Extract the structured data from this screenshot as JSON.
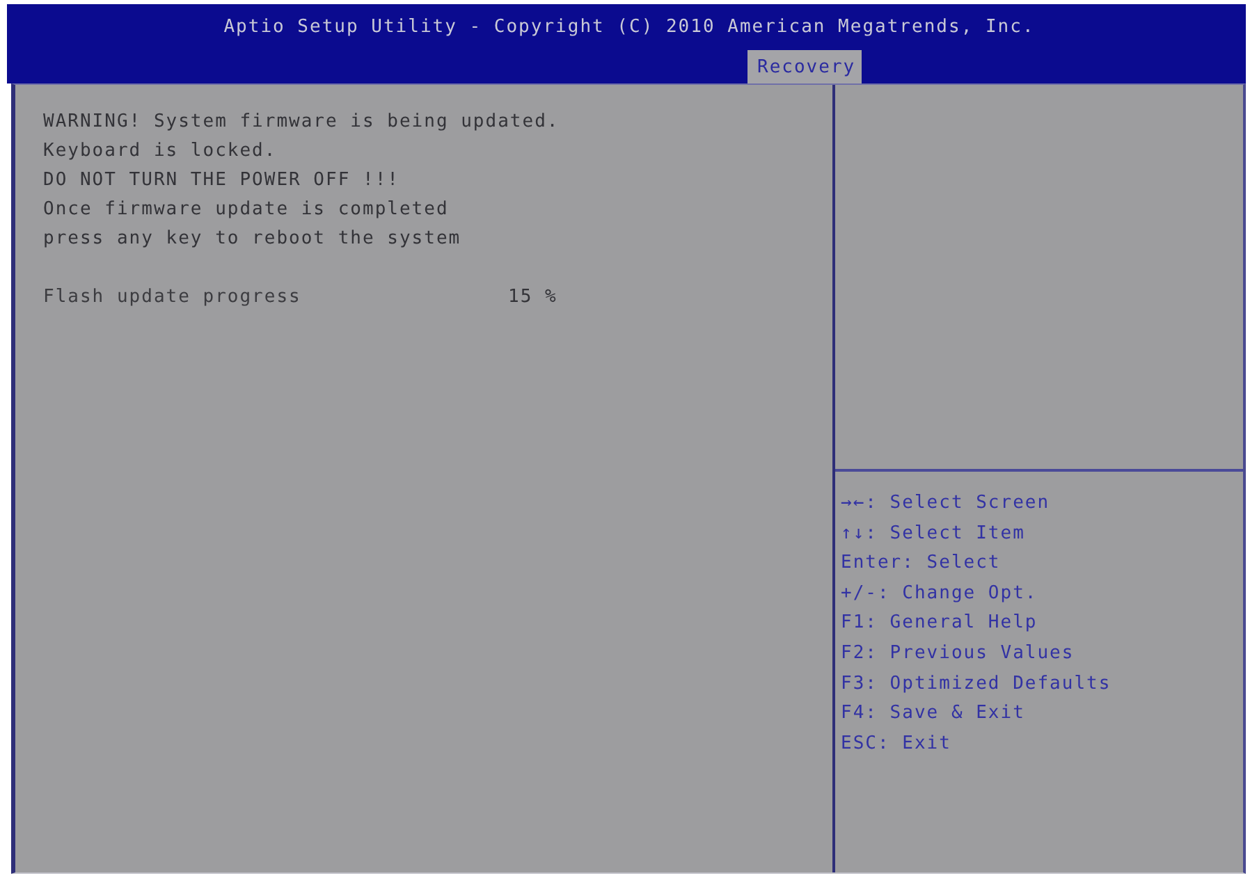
{
  "header": {
    "title": "Aptio Setup Utility - Copyright (C) 2010 American Megatrends, Inc."
  },
  "tabs": [
    {
      "label": "Recovery",
      "selected": true
    }
  ],
  "message": {
    "lines": [
      "WARNING! System firmware is being updated.",
      "Keyboard is locked.",
      "DO NOT TURN THE POWER OFF !!!",
      "Once firmware update is completed",
      "press any key to reboot the system"
    ]
  },
  "progress": {
    "label": "Flash update progress",
    "value": "15 %"
  },
  "help": {
    "items": [
      "→←: Select Screen",
      "↑↓: Select Item",
      "Enter: Select",
      "+/-: Change Opt.",
      "F1: General Help",
      "F2: Previous Values",
      "F3: Optimized Defaults",
      "F4: Save & Exit",
      "ESC: Exit"
    ]
  }
}
